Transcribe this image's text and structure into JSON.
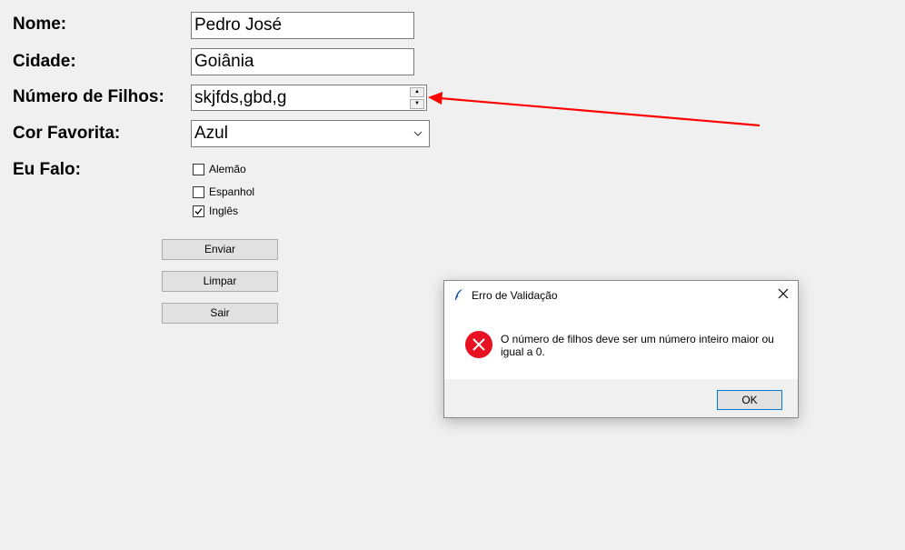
{
  "form": {
    "labels": {
      "nome": "Nome:",
      "cidade": "Cidade:",
      "filhos": "Número de Filhos:",
      "cor": "Cor Favorita:",
      "falo": "Eu Falo:"
    },
    "values": {
      "nome": "Pedro José",
      "cidade": "Goiânia",
      "filhos": "skjfds,gbd,g",
      "cor": "Azul"
    },
    "languages": [
      {
        "label": "Alemão",
        "checked": false
      },
      {
        "label": "Espanhol",
        "checked": false
      },
      {
        "label": "Inglês",
        "checked": true
      }
    ],
    "buttons": {
      "enviar": "Enviar",
      "limpar": "Limpar",
      "sair": "Sair"
    }
  },
  "dialog": {
    "title": "Erro de Validação",
    "message": "O número de filhos deve ser um número inteiro maior ou igual a 0.",
    "ok_label": "OK",
    "icons": {
      "title": "feather-icon",
      "close": "close-icon",
      "status": "error-icon"
    }
  },
  "colors": {
    "error_red": "#e81123",
    "annotation_red": "#ff0000",
    "focus_blue": "#0078d7"
  }
}
